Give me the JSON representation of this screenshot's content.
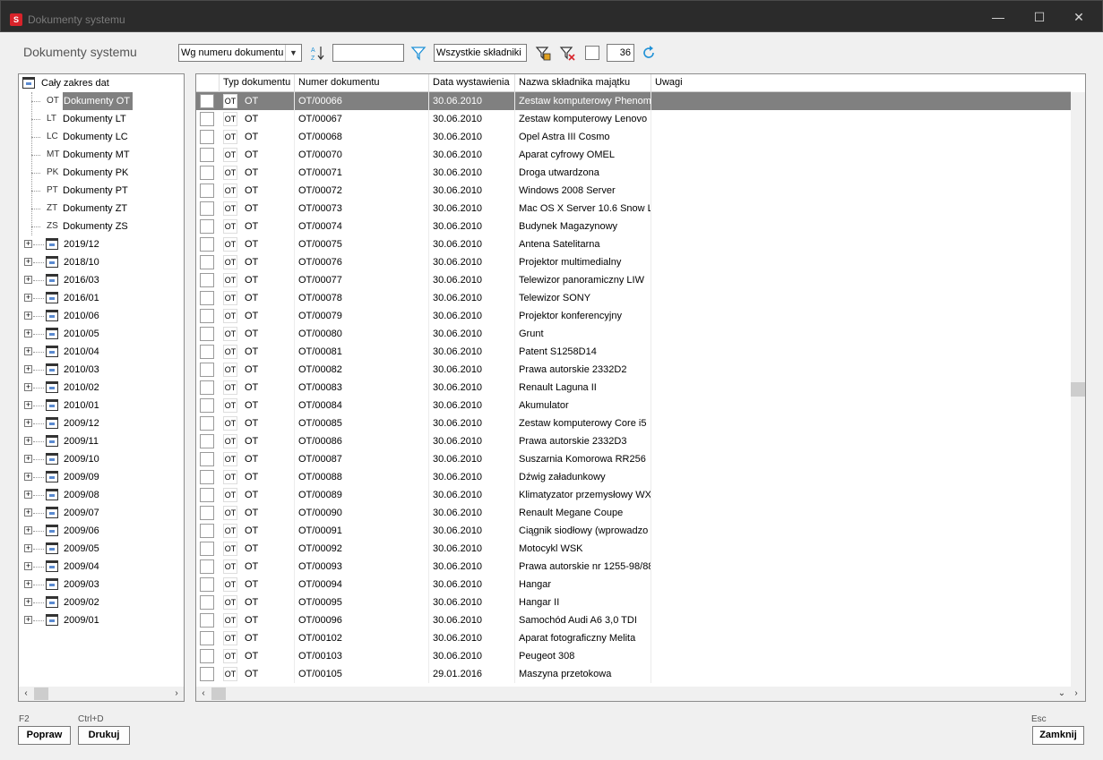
{
  "window": {
    "title": "Dokumenty systemu",
    "app_icon": "S",
    "minimize": "—",
    "maximize": "☐",
    "close": "✕"
  },
  "toolbar": {
    "page_title": "Dokumenty systemu",
    "sort_combo": "Wg numeru dokumentu",
    "search_value": "",
    "filter_label": "Wszystkie składniki",
    "limit_value": "36"
  },
  "tree": {
    "root": "Cały zakres dat",
    "docs": [
      {
        "abbr": "OT",
        "label": "Dokumenty OT",
        "selected": true
      },
      {
        "abbr": "LT",
        "label": "Dokumenty LT"
      },
      {
        "abbr": "LC",
        "label": "Dokumenty LC"
      },
      {
        "abbr": "MT",
        "label": "Dokumenty MT"
      },
      {
        "abbr": "PK",
        "label": "Dokumenty PK"
      },
      {
        "abbr": "PT",
        "label": "Dokumenty PT"
      },
      {
        "abbr": "ZT",
        "label": "Dokumenty ZT"
      },
      {
        "abbr": "ZS",
        "label": "Dokumenty ZS"
      }
    ],
    "periods": [
      "2019/12",
      "2018/10",
      "2016/03",
      "2016/01",
      "2010/06",
      "2010/05",
      "2010/04",
      "2010/03",
      "2010/02",
      "2010/01",
      "2009/12",
      "2009/11",
      "2009/10",
      "2009/09",
      "2009/08",
      "2009/07",
      "2009/06",
      "2009/05",
      "2009/04",
      "2009/03",
      "2009/02",
      "2009/01"
    ]
  },
  "grid": {
    "columns": [
      "Typ dokumentu",
      "Numer dokumentu",
      "Data wystawienia",
      "Nazwa składnika majątku",
      "Uwagi"
    ],
    "rows": [
      [
        "OT",
        "OT/00066",
        "30.06.2010",
        "Zestaw komputerowy Phenom"
      ],
      [
        "OT",
        "OT/00067",
        "30.06.2010",
        "Zestaw komputerowy Lenovo"
      ],
      [
        "OT",
        "OT/00068",
        "30.06.2010",
        "Opel Astra III Cosmo"
      ],
      [
        "OT",
        "OT/00070",
        "30.06.2010",
        "Aparat cyfrowy OMEL"
      ],
      [
        "OT",
        "OT/00071",
        "30.06.2010",
        "Droga utwardzona"
      ],
      [
        "OT",
        "OT/00072",
        "30.06.2010",
        "Windows 2008 Server"
      ],
      [
        "OT",
        "OT/00073",
        "30.06.2010",
        "Mac OS X Server 10.6 Snow L"
      ],
      [
        "OT",
        "OT/00074",
        "30.06.2010",
        "Budynek Magazynowy"
      ],
      [
        "OT",
        "OT/00075",
        "30.06.2010",
        "Antena Satelitarna"
      ],
      [
        "OT",
        "OT/00076",
        "30.06.2010",
        "Projektor multimedialny"
      ],
      [
        "OT",
        "OT/00077",
        "30.06.2010",
        "Telewizor panoramiczny LIW"
      ],
      [
        "OT",
        "OT/00078",
        "30.06.2010",
        "Telewizor SONY"
      ],
      [
        "OT",
        "OT/00079",
        "30.06.2010",
        "Projektor konferencyjny"
      ],
      [
        "OT",
        "OT/00080",
        "30.06.2010",
        "Grunt"
      ],
      [
        "OT",
        "OT/00081",
        "30.06.2010",
        "Patent S1258D14"
      ],
      [
        "OT",
        "OT/00082",
        "30.06.2010",
        "Prawa autorskie 2332D2"
      ],
      [
        "OT",
        "OT/00083",
        "30.06.2010",
        "Renault Laguna II"
      ],
      [
        "OT",
        "OT/00084",
        "30.06.2010",
        "Akumulator"
      ],
      [
        "OT",
        "OT/00085",
        "30.06.2010",
        "Zestaw komputerowy Core i5"
      ],
      [
        "OT",
        "OT/00086",
        "30.06.2010",
        "Prawa autorskie 2332D3"
      ],
      [
        "OT",
        "OT/00087",
        "30.06.2010",
        "Suszarnia Komorowa RR256"
      ],
      [
        "OT",
        "OT/00088",
        "30.06.2010",
        "Dźwig załadunkowy"
      ],
      [
        "OT",
        "OT/00089",
        "30.06.2010",
        "Klimatyzator przemysłowy WX"
      ],
      [
        "OT",
        "OT/00090",
        "30.06.2010",
        "Renault Megane Coupe"
      ],
      [
        "OT",
        "OT/00091",
        "30.06.2010",
        "Ciągnik siodłowy (wprowadzo"
      ],
      [
        "OT",
        "OT/00092",
        "30.06.2010",
        "Motocykl WSK"
      ],
      [
        "OT",
        "OT/00093",
        "30.06.2010",
        "Prawa autorskie nr 1255-98/88"
      ],
      [
        "OT",
        "OT/00094",
        "30.06.2010",
        "Hangar"
      ],
      [
        "OT",
        "OT/00095",
        "30.06.2010",
        "Hangar II"
      ],
      [
        "OT",
        "OT/00096",
        "30.06.2010",
        "Samochód Audi A6 3,0 TDI"
      ],
      [
        "OT",
        "OT/00102",
        "30.06.2010",
        "Aparat fotograficzny Melita"
      ],
      [
        "OT",
        "OT/00103",
        "30.06.2010",
        "Peugeot 308"
      ],
      [
        "OT",
        "OT/00105",
        "29.01.2016",
        "Maszyna przetokowa"
      ]
    ]
  },
  "footer": {
    "edit_key": "F2",
    "edit_label": "Popraw",
    "print_key": "Ctrl+D",
    "print_label": "Drukuj",
    "close_key": "Esc",
    "close_label": "Zamknij"
  },
  "scroll": {
    "left": "‹",
    "right": "›",
    "down": "⌄"
  },
  "colors": {
    "selection": "#808080",
    "titlebar": "#2b2b2b",
    "accent": "#1e90d6",
    "app_icon": "#d8232a"
  }
}
